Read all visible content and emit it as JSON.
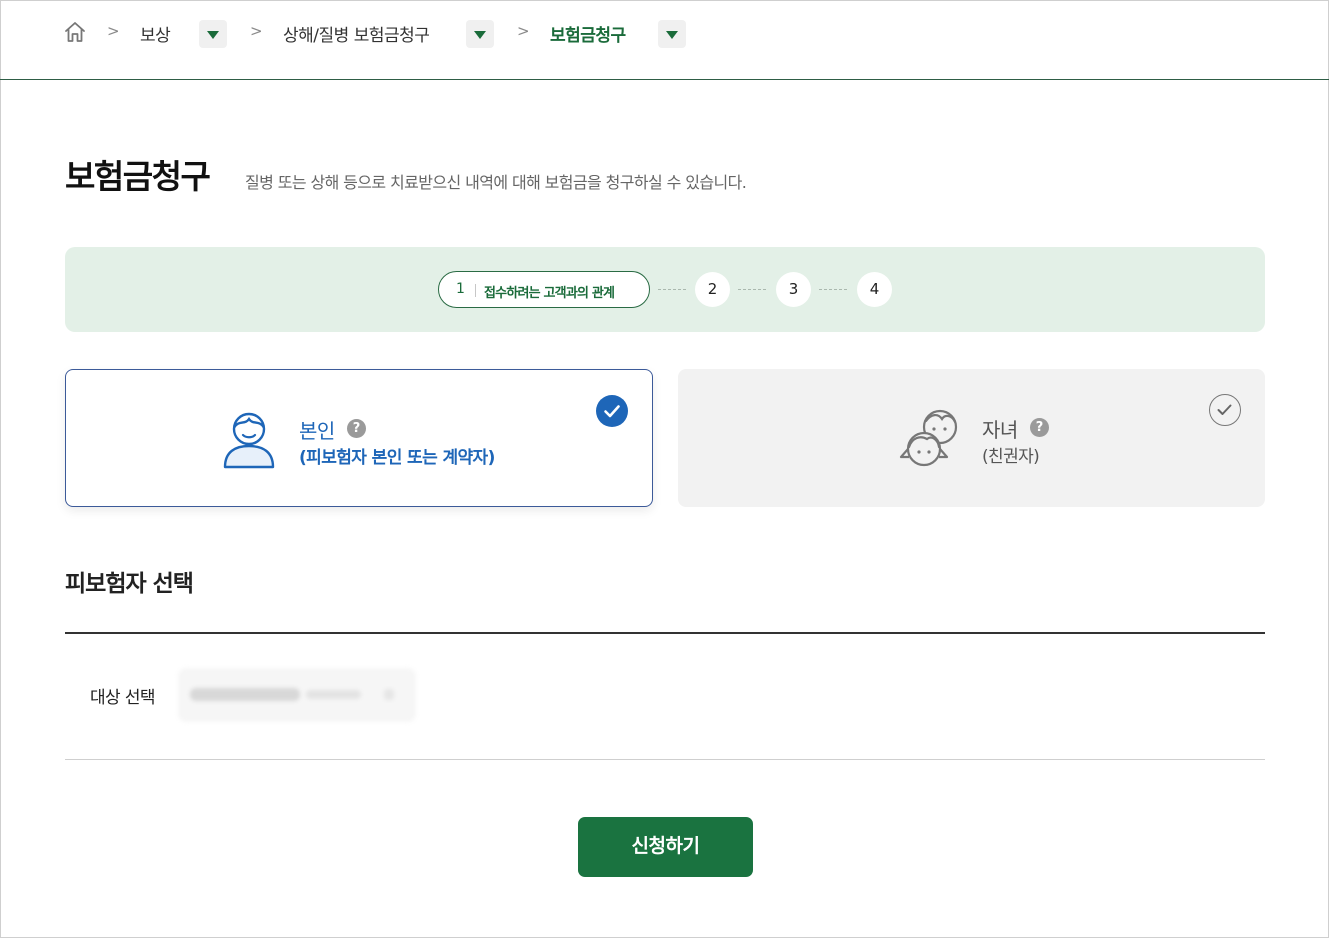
{
  "breadcrumb": {
    "home_icon": "home-icon",
    "separator": ">",
    "items": [
      {
        "label": "보상"
      },
      {
        "label": "상해/질병 보험금청구"
      },
      {
        "label": "보험금청구"
      }
    ]
  },
  "page": {
    "title": "보험금청구",
    "description": "질병 또는 상해 등으로 치료받으신 내역에 대해 보험금을 청구하실 수 있습니다."
  },
  "stepper": {
    "active_step": {
      "number": "1",
      "label": "접수하려는 고객과의 관계"
    },
    "steps": [
      "2",
      "3",
      "4"
    ],
    "background_color": "#e3f0e7"
  },
  "relation_options": [
    {
      "title": "본인",
      "subtitle": "(피보험자 본인 또는 계약자)",
      "help_icon": "question-icon",
      "selected": true,
      "icon": "person-icon"
    },
    {
      "title": "자녀",
      "subtitle": "(친권자)",
      "help_icon": "question-icon",
      "selected": false,
      "icon": "children-icon"
    }
  ],
  "insured_section": {
    "title": "피보험자 선택",
    "field_label": "대상 선택"
  },
  "submit": {
    "label": "신청하기"
  },
  "colors": {
    "brand_green": "#1a7340",
    "selected_blue": "#1e66b8",
    "selected_text": "#1e66b8"
  }
}
